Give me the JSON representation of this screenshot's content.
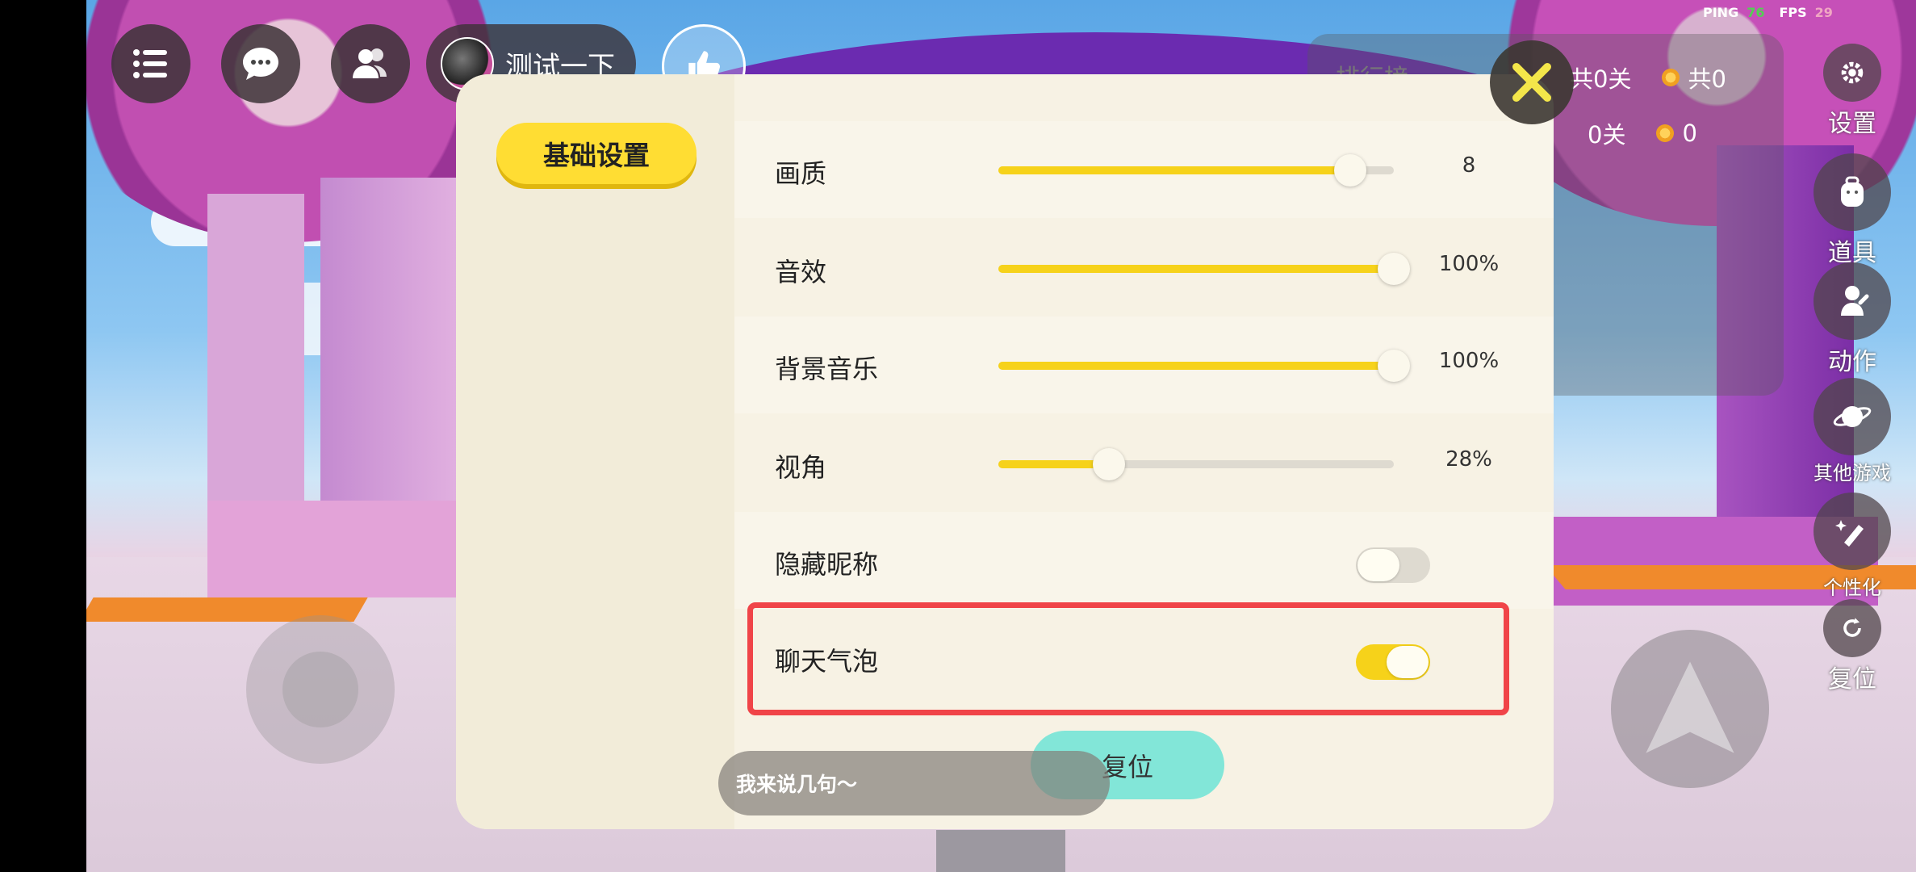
{
  "hud": {
    "player_name": "测试一下",
    "ping_label": "PING",
    "ping_value": "76",
    "fps_label": "FPS",
    "fps_value": "29"
  },
  "ranking": {
    "title": "排行榜",
    "row1_levels": "共0关",
    "row1_coins": "共0",
    "row2_levels": "0关",
    "row2_coins": "0"
  },
  "side_menu": {
    "settings": "设置",
    "items": "道具",
    "actions": "动作",
    "other_games": "其他游戏",
    "personalize": "个性化",
    "reset_position": "复位"
  },
  "settings": {
    "tab_basic": "基础设置",
    "rows": [
      {
        "label": "画质",
        "value_text": "8",
        "fraction": 0.89
      },
      {
        "label": "音效",
        "value_text": "100%",
        "fraction": 1.0
      },
      {
        "label": "背景音乐",
        "value_text": "100%",
        "fraction": 1.0
      },
      {
        "label": "视角",
        "value_text": "28%",
        "fraction": 0.28
      }
    ],
    "hide_nickname_label": "隐藏昵称",
    "hide_nickname_on": false,
    "chat_bubble_label": "聊天气泡",
    "chat_bubble_on": true,
    "reset_button": "复位"
  },
  "chat": {
    "placeholder": "我来说几句～"
  },
  "colors": {
    "accent_yellow": "#f6d21a",
    "reset_teal": "#82e6d8",
    "highlight_red": "#f04448"
  }
}
